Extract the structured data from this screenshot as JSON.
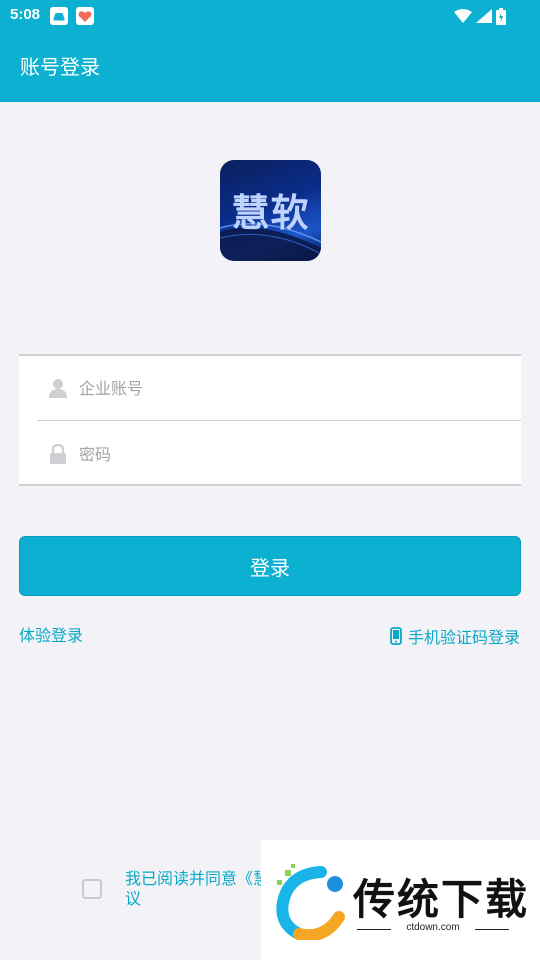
{
  "status_bar": {
    "time": "5:08"
  },
  "app_bar": {
    "title": "账号登录"
  },
  "logo": {
    "text": "慧软"
  },
  "form": {
    "account_placeholder": "企业账号",
    "password_placeholder": "密码"
  },
  "login_button": "登录",
  "links": {
    "trial": "体验登录",
    "sms": "手机验证码登录"
  },
  "agreement": {
    "text": "我已阅读并同意《慧",
    "text_line2": "议"
  },
  "watermark": {
    "title": "传统下载",
    "site": "ctdown.com"
  },
  "colors": {
    "primary": "#0cb1d1",
    "link": "#0aa8c7",
    "background": "#f3f3f7"
  }
}
